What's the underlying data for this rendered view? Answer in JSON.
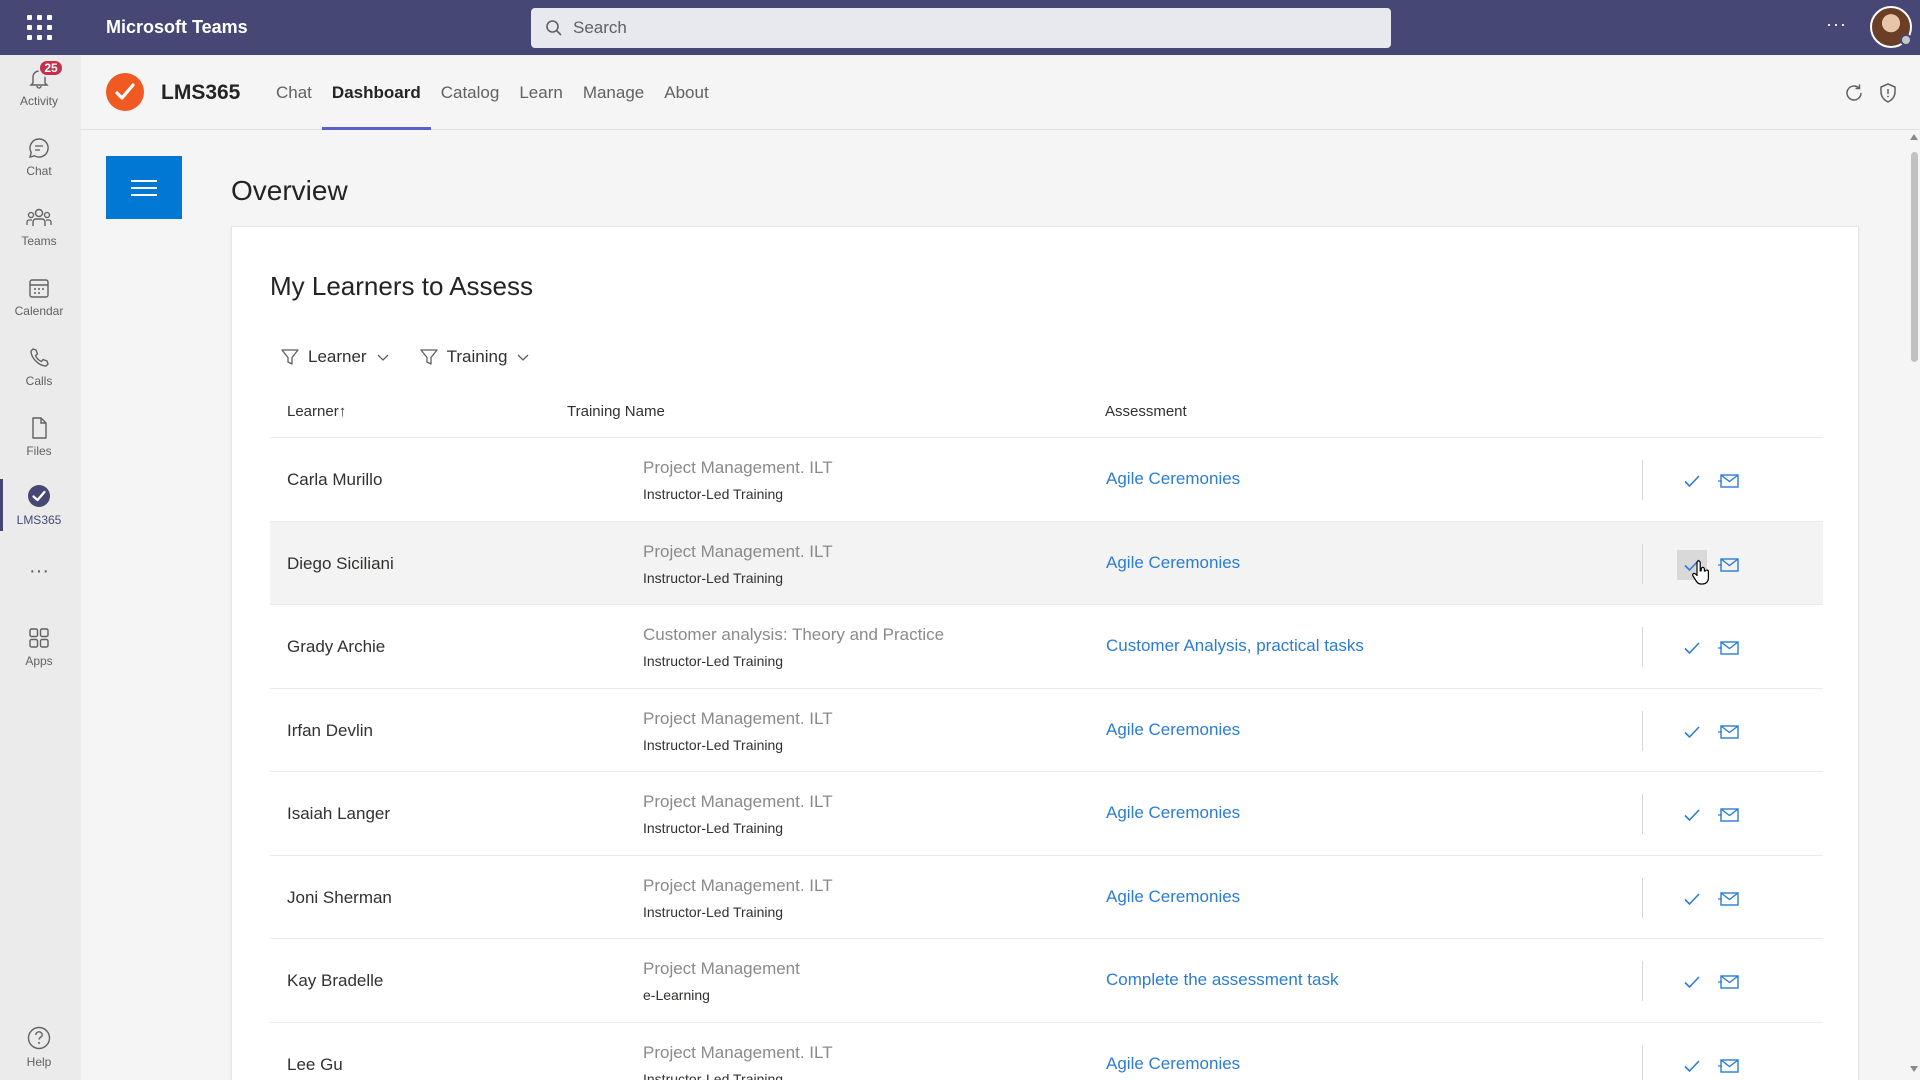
{
  "topbar": {
    "app_title": "Microsoft Teams",
    "search_placeholder": "Search",
    "more_label": "···"
  },
  "rail": {
    "activity": {
      "label": "Activity",
      "badge": "25"
    },
    "chat": {
      "label": "Chat"
    },
    "teams": {
      "label": "Teams"
    },
    "calendar": {
      "label": "Calendar"
    },
    "calls": {
      "label": "Calls"
    },
    "files": {
      "label": "Files"
    },
    "lms365": {
      "label": "LMS365"
    },
    "more": {
      "label": "···"
    },
    "apps": {
      "label": "Apps"
    },
    "help": {
      "label": "Help"
    }
  },
  "app_header": {
    "name": "LMS365",
    "tabs": [
      {
        "label": "Chat"
      },
      {
        "label": "Dashboard"
      },
      {
        "label": "Catalog"
      },
      {
        "label": "Learn"
      },
      {
        "label": "Manage"
      },
      {
        "label": "About"
      }
    ],
    "active_tab": "Dashboard"
  },
  "main": {
    "page_title": "Overview",
    "card_title": "My Learners to Assess",
    "filters": [
      {
        "label": "Learner"
      },
      {
        "label": "Training"
      }
    ],
    "columns": {
      "learner": "Learner",
      "learner_sort": "↑",
      "training": "Training Name",
      "assessment": "Assessment"
    },
    "rows": [
      {
        "learner": "Carla Murillo",
        "training": "Project Management. ILT",
        "training_type": "Instructor-Led Training",
        "assessment": "Agile Ceremonies"
      },
      {
        "learner": "Diego Siciliani",
        "training": "Project Management. ILT",
        "training_type": "Instructor-Led Training",
        "assessment": "Agile Ceremonies"
      },
      {
        "learner": "Grady Archie",
        "training": "Customer analysis: Theory and Practice",
        "training_type": "Instructor-Led Training",
        "assessment": "Customer Analysis, practical tasks"
      },
      {
        "learner": "Irfan Devlin",
        "training": "Project Management. ILT",
        "training_type": "Instructor-Led Training",
        "assessment": "Agile Ceremonies"
      },
      {
        "learner": "Isaiah Langer",
        "training": "Project Management. ILT",
        "training_type": "Instructor-Led Training",
        "assessment": "Agile Ceremonies"
      },
      {
        "learner": "Joni Sherman",
        "training": "Project Management. ILT",
        "training_type": "Instructor-Led Training",
        "assessment": "Agile Ceremonies"
      },
      {
        "learner": "Kay Bradelle",
        "training": "Project Management",
        "training_type": "e-Learning",
        "assessment": "Complete the assessment task"
      },
      {
        "learner": "Lee Gu",
        "training": "Project Management. ILT",
        "training_type": "Instructor-Led Training",
        "assessment": "Agile Ceremonies"
      }
    ]
  },
  "colors": {
    "teams_purple": "#464775",
    "accent_blue": "#0078d4",
    "link_blue": "#2b7cd3",
    "lms_orange": "#f05a22",
    "badge_red": "#c4314b"
  }
}
